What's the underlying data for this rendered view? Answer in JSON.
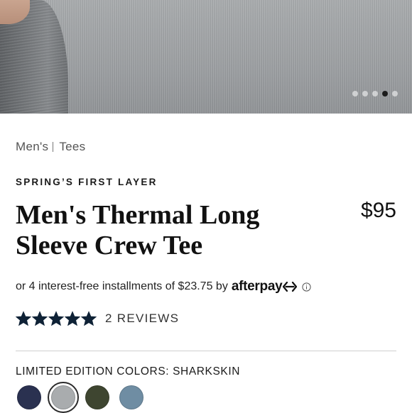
{
  "hero": {
    "dots": [
      {
        "active": false
      },
      {
        "active": false
      },
      {
        "active": false
      },
      {
        "active": true
      },
      {
        "active": false
      }
    ]
  },
  "breadcrumb": {
    "items": [
      "Men's",
      "Tees"
    ]
  },
  "product": {
    "eyebrow": "SPRING’S FIRST LAYER",
    "title": "Men's Thermal Long Sleeve Crew Tee",
    "price": "$95"
  },
  "afterpay": {
    "text": "or 4 interest-free installments of $23.75 by",
    "brand": "afterpay"
  },
  "reviews": {
    "rating": 5,
    "max_rating": 5,
    "label": "2 REVIEWS"
  },
  "colors": {
    "label": "LIMITED EDITION COLORS: SHARKSKIN",
    "swatches": [
      {
        "color": "#2a3150",
        "selected": false
      },
      {
        "color": "#a9acae",
        "selected": true
      },
      {
        "color": "#3e4530",
        "selected": false
      },
      {
        "color": "#6f8da3",
        "selected": false
      }
    ]
  },
  "theme": {
    "star_color": "#0f2236"
  }
}
